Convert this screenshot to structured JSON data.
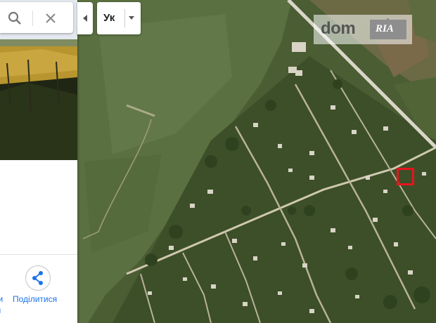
{
  "language": {
    "label": "Ук"
  },
  "actions": {
    "share_label": "Поділитися",
    "previous_label_fragment": "ти",
    "previous_sub_fragment": "он"
  },
  "logo": {
    "dom": "dom",
    "ria": "RIA"
  },
  "colors": {
    "accent": "#1a73e8",
    "marker": "#e8141c"
  }
}
